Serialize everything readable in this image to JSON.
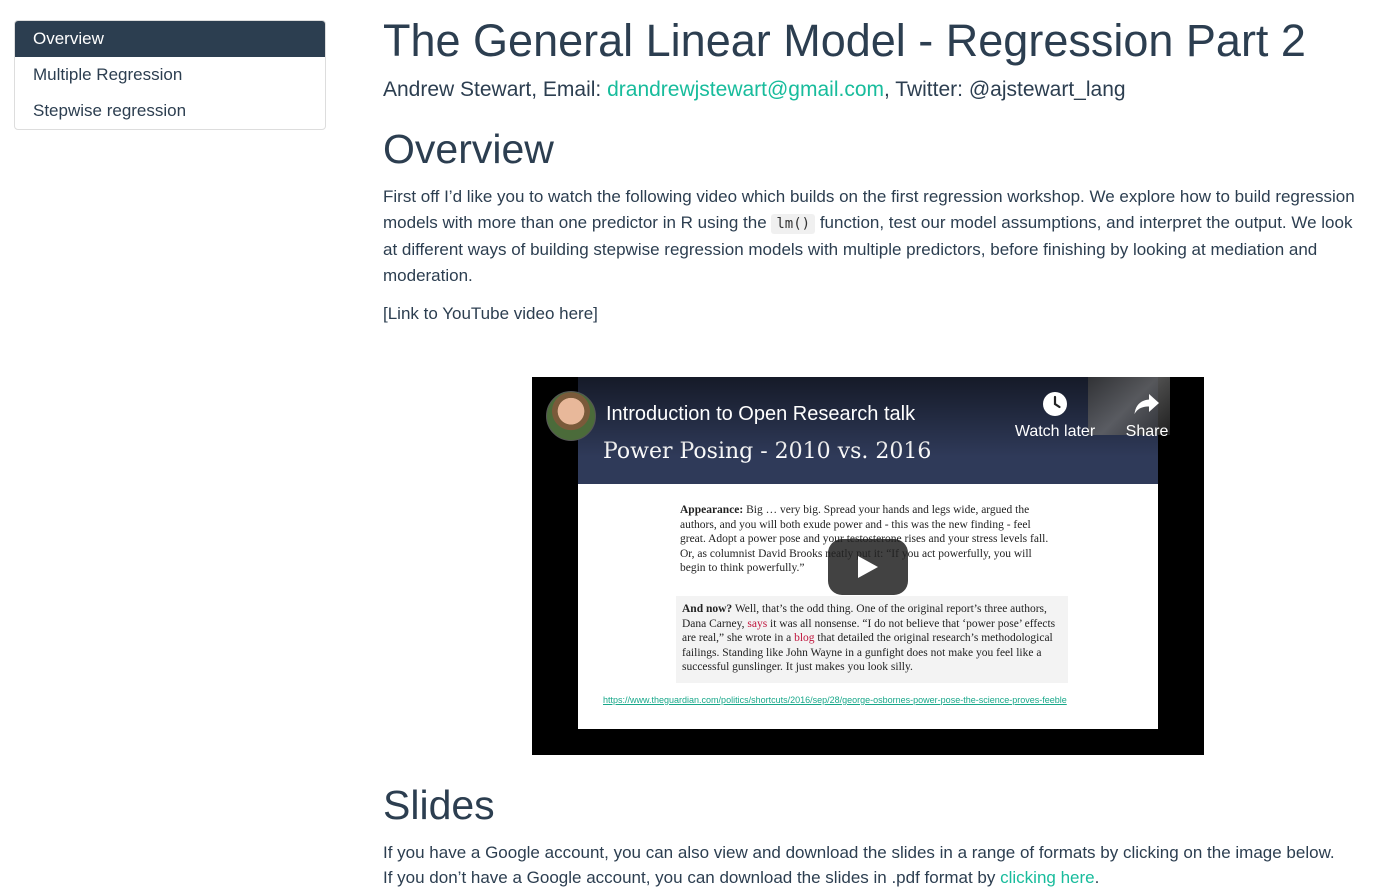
{
  "toc": {
    "items": [
      {
        "label": "Overview",
        "active": true
      },
      {
        "label": "Multiple Regression",
        "active": false
      },
      {
        "label": "Stepwise regression",
        "active": false
      }
    ]
  },
  "header": {
    "title": "The General Linear Model - Regression Part 2",
    "author_prefix": "Andrew Stewart, Email: ",
    "email": "drandrewjstewart@gmail.com",
    "author_suffix": ", Twitter: @ajstewart_lang"
  },
  "overview": {
    "heading": "Overview",
    "para_before_code": "First off I’d like you to watch the following video which builds on the first regression workshop. We explore how to build regression models with more than one predictor in R using the ",
    "code": "lm()",
    "para_after_code": " function, test our model assumptions, and interpret the output. We look at different ways of building stepwise regression models with multiple predictors, before finishing by looking at mediation and moderation.",
    "link_text": "[Link to YouTube video here]"
  },
  "video": {
    "title": "Introduction to Open Research talk",
    "watch_later": "Watch later",
    "share": "Share",
    "slide_title": "Power Posing - 2010 vs. 2016",
    "quote1_bold": "Appearance:",
    "quote1_text": " Big … very big. Spread your hands and legs wide, argued the authors, and you will both exude power and - this was the new finding - feel great. Adopt a power pose and your testosterone rises and your stress levels fall. Or, as columnist David Brooks neatly put it: “If you act powerfully, you will begin to think powerfully.”",
    "quote2_bold": "And now?",
    "quote2_text_a": " Well, that’s the odd thing. One of the original report’s three authors, Dana Carney, ",
    "quote2_red_a": "says",
    "quote2_text_b": " it was all nonsense. “I do not believe that ‘power pose’ effects are real,” she wrote in a ",
    "quote2_red_b": "blog",
    "quote2_text_c": " that detailed the original research’s methodological failings. Standing like John Wayne in a gunfight does not make you feel like a successful gunslinger. It just makes you look silly.",
    "slide_url": "https://www.theguardian.com/politics/shortcuts/2016/sep/28/george-osbornes-power-pose-the-science-proves-feeble"
  },
  "slides": {
    "heading": "Slides",
    "line1": "If you have a Google account, you can also view and download the slides in a range of formats by clicking on the image below.",
    "line2_prefix": "If you don’t have a Google account, you can download the slides in .pdf format by ",
    "line2_link": "clicking here",
    "line2_suffix": "."
  },
  "colors": {
    "text": "#2c3e50",
    "link": "#18bc9c",
    "toc_active_bg": "#2c3e50"
  }
}
